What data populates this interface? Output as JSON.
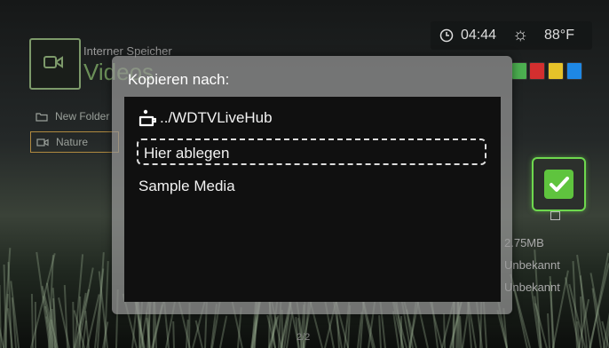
{
  "status": {
    "time": "04:44",
    "temperature": "88°F"
  },
  "header": {
    "storage_label": "Interner Speicher",
    "section_title": "Videos"
  },
  "color_buttons": [
    {
      "name": "green",
      "color": "#4caf50"
    },
    {
      "name": "red",
      "color": "#d32f2f"
    },
    {
      "name": "yellow",
      "color": "#e6c229"
    },
    {
      "name": "blue",
      "color": "#1e88e5"
    }
  ],
  "background_list": {
    "items": [
      "New Folder",
      "Nature"
    ]
  },
  "right_info": {
    "size": "2.75MB",
    "line2": "Unbekannt",
    "line3": "Unbekannt"
  },
  "pager": "2/2",
  "dialog": {
    "title": "Kopieren nach:",
    "up_label": "../WDTVLiveHub",
    "drop_label": "Hier ablegen",
    "items": [
      "Sample Media"
    ]
  },
  "accent_color": "#6ed84e"
}
